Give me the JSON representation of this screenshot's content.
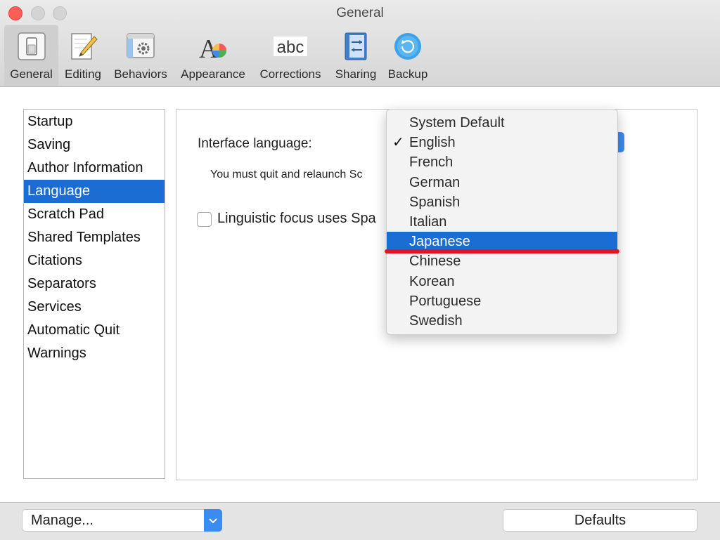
{
  "window": {
    "title": "General"
  },
  "toolbar": {
    "items": [
      {
        "label": "General",
        "icon": "switch-icon",
        "selected": true
      },
      {
        "label": "Editing",
        "icon": "pencil-icon"
      },
      {
        "label": "Behaviors",
        "icon": "gear-window-icon"
      },
      {
        "label": "Appearance",
        "icon": "font-color-icon"
      },
      {
        "label": "Corrections",
        "icon": "abc-icon"
      },
      {
        "label": "Sharing",
        "icon": "sharing-arrows-icon"
      },
      {
        "label": "Backup",
        "icon": "backup-icon"
      }
    ],
    "corrections_icon_text": "abc"
  },
  "sidebar": {
    "items": [
      {
        "label": "Startup"
      },
      {
        "label": "Saving"
      },
      {
        "label": "Author Information"
      },
      {
        "label": "Language",
        "selected": true
      },
      {
        "label": "Scratch Pad"
      },
      {
        "label": "Shared Templates"
      },
      {
        "label": "Citations"
      },
      {
        "label": "Separators"
      },
      {
        "label": "Services"
      },
      {
        "label": "Automatic Quit"
      },
      {
        "label": "Warnings"
      }
    ]
  },
  "panel": {
    "interface_language_label": "Interface language:",
    "relaunch_hint": "You must quit and relaunch Sc",
    "linguistic_focus_label": "Linguistic focus uses Spa",
    "linguistic_focus_checked": false
  },
  "language_menu": {
    "checked_mark": "✓",
    "items": [
      {
        "label": "System Default"
      },
      {
        "label": "English",
        "checked": true
      },
      {
        "label": "French"
      },
      {
        "label": "German"
      },
      {
        "label": "Spanish"
      },
      {
        "label": "Italian"
      },
      {
        "label": "Japanese",
        "highlighted": true
      },
      {
        "label": "Chinese"
      },
      {
        "label": "Korean"
      },
      {
        "label": "Portuguese"
      },
      {
        "label": "Swedish"
      }
    ],
    "annotation_color": "#e8131b"
  },
  "bottom": {
    "manage_label": "Manage...",
    "defaults_label": "Defaults"
  },
  "colors": {
    "accent": "#1b6dd3",
    "control_blue": "#3b8cf0"
  }
}
